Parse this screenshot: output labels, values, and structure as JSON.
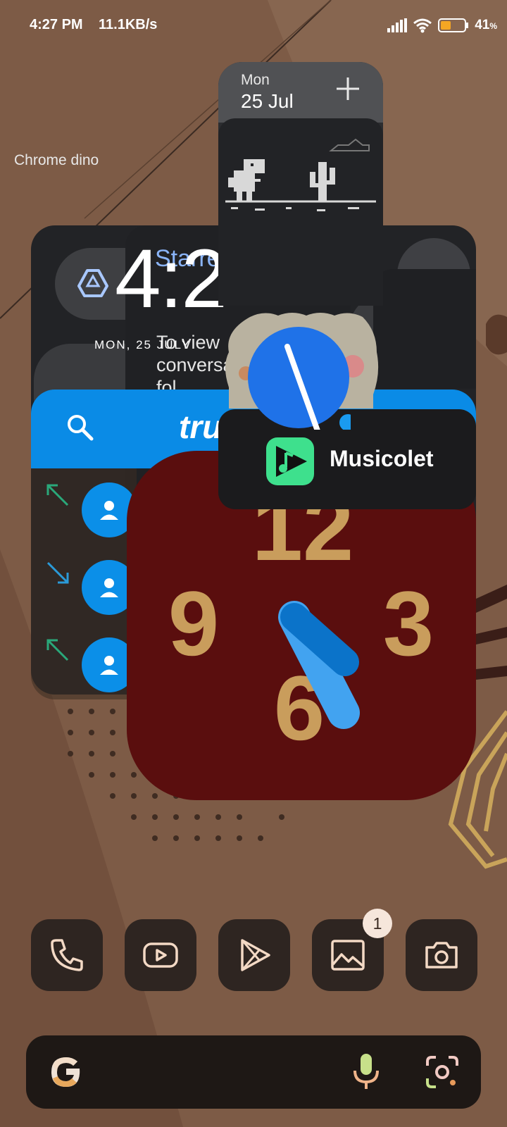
{
  "status_bar": {
    "time": "4:27 PM",
    "network_speed": "11.1KB/s",
    "battery_percent": "41",
    "battery_unit": "%",
    "icons": [
      "signal-icon",
      "wifi-icon",
      "battery-icon"
    ]
  },
  "widgets": {
    "clock": {
      "time_partial": "4:2",
      "date": "MON, 25 JULY"
    },
    "gmail": {
      "title_partial": "Starre",
      "body_partial": "To view conversa this fol"
    },
    "calendar": {
      "day": "Mon",
      "date": "25 Jul",
      "add_icon": "plus-icon"
    },
    "chrome_dino": {
      "label": "Chrome dino"
    },
    "truecaller": {
      "logo_partial": "tru"
    },
    "music": {
      "label": "Musicolet"
    },
    "analog_clock": {
      "numbers": [
        "12",
        "3",
        "6",
        "9"
      ]
    }
  },
  "dock": {
    "apps": [
      {
        "name": "Phone",
        "icon": "phone-icon"
      },
      {
        "name": "YouTube",
        "icon": "youtube-icon"
      },
      {
        "name": "Play Store",
        "icon": "play-store-icon"
      },
      {
        "name": "Gallery",
        "icon": "gallery-icon",
        "badge": "1"
      },
      {
        "name": "Camera",
        "icon": "camera-icon"
      }
    ]
  },
  "search_bar": {
    "icons": [
      "google-icon",
      "mic-icon",
      "lens-icon"
    ]
  },
  "colors": {
    "wallpaper": "#7a5a45",
    "truecaller_blue": "#0a8be6",
    "clock_red": "#5a0e0e",
    "clock_numbers": "#c99d5c",
    "dock_tile": "#2e2521"
  }
}
